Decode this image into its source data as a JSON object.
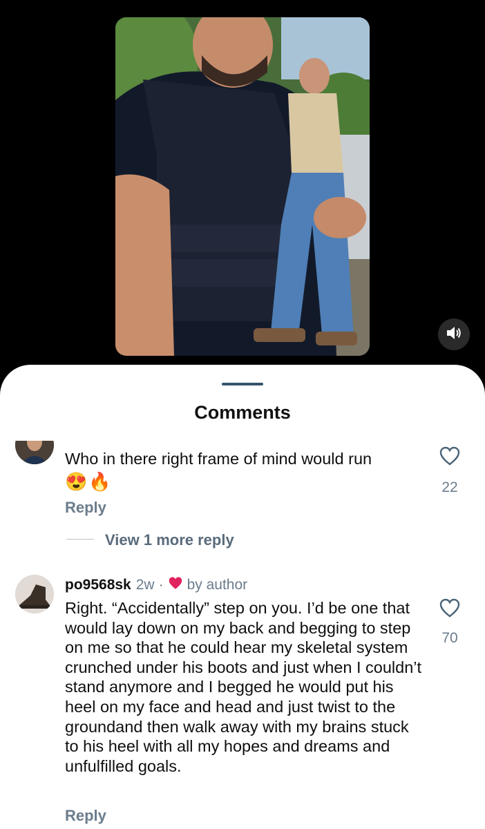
{
  "video": {
    "mute_icon": "speaker-on-icon"
  },
  "sheet": {
    "title": "Comments"
  },
  "comments": [
    {
      "text": "Who in there right frame of mind would run",
      "emojis": "😍🔥",
      "likes": "22",
      "reply_label": "Reply",
      "view_more_label": "View 1 more reply"
    },
    {
      "username": "po9568sk",
      "time": "2w",
      "separator": "·",
      "liked_by": "by author",
      "text": "Right. “Accidentally” step on you. I’d be one that would lay down on my back and begging to step on me so that he could hear my skeletal system crunched under his boots and just when I couldn’t stand anymore and I begged he would put his heel on my face and head and just twist to the groundand then walk away with my brains stuck to his heel with all my hopes and dreams and unfulfilled goals.",
      "likes": "70",
      "reply_label": "Reply"
    }
  ],
  "colors": {
    "accent_heart": "#e0245e",
    "muted_text": "#6b7c8c"
  }
}
